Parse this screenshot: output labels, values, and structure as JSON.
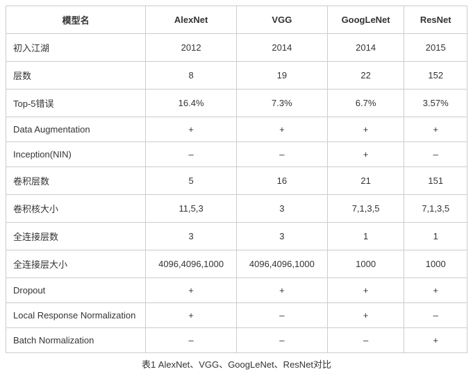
{
  "chart_data": {
    "type": "table",
    "title": "表1 AlexNet、VGG、GoogLeNet、ResNet对比",
    "columns": [
      "模型名",
      "AlexNet",
      "VGG",
      "GoogLeNet",
      "ResNet"
    ],
    "rows": [
      {
        "label": "初入江湖",
        "values": [
          "2012",
          "2014",
          "2014",
          "2015"
        ]
      },
      {
        "label": "层数",
        "values": [
          "8",
          "19",
          "22",
          "152"
        ]
      },
      {
        "label": "Top-5错误",
        "values": [
          "16.4%",
          "7.3%",
          "6.7%",
          "3.57%"
        ]
      },
      {
        "label": "Data Augmentation",
        "values": [
          "+",
          "+",
          "+",
          "+"
        ]
      },
      {
        "label": "Inception(NIN)",
        "values": [
          "–",
          "–",
          "+",
          "–"
        ]
      },
      {
        "label": "卷积层数",
        "values": [
          "5",
          "16",
          "21",
          "151"
        ]
      },
      {
        "label": "卷积核大小",
        "values": [
          "11,5,3",
          "3",
          "7,1,3,5",
          "7,1,3,5"
        ]
      },
      {
        "label": "全连接层数",
        "values": [
          "3",
          "3",
          "1",
          "1"
        ]
      },
      {
        "label": "全连接层大小",
        "values": [
          "4096,4096,1000",
          "4096,4096,1000",
          "1000",
          "1000"
        ]
      },
      {
        "label": "Dropout",
        "values": [
          "+",
          "+",
          "+",
          "+"
        ]
      },
      {
        "label": "Local Response Normalization",
        "values": [
          "+",
          "–",
          "+",
          "–"
        ]
      },
      {
        "label": "Batch Normalization",
        "values": [
          "–",
          "–",
          "–",
          "+"
        ]
      }
    ]
  }
}
